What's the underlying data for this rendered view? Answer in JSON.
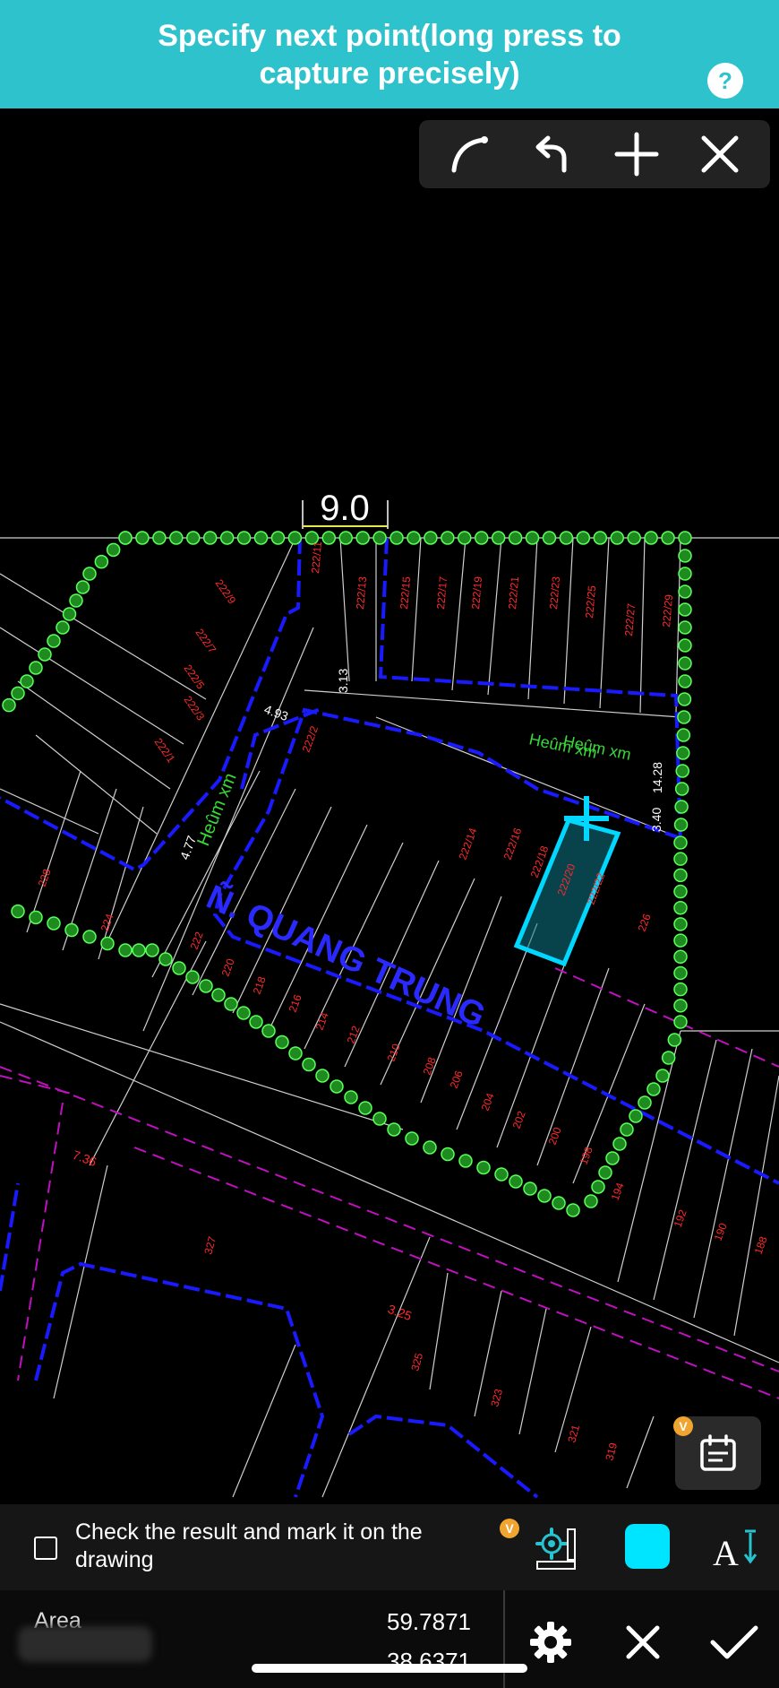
{
  "banner": {
    "title": "Specify next point(long press to capture precisely)",
    "help_icon": "question-mark-icon"
  },
  "toolbar": {
    "items": [
      {
        "name": "arc-tool-button",
        "icon": "arc-icon"
      },
      {
        "name": "undo-button",
        "icon": "undo-arrow-icon"
      },
      {
        "name": "add-point-button",
        "icon": "plus-icon"
      },
      {
        "name": "close-button",
        "icon": "close-icon"
      }
    ]
  },
  "drawing": {
    "dimension_label": "9.0",
    "street_label": "Ñ. QUANG TRUNG",
    "alley_labels": [
      "Heûm xm",
      "Heûm xm",
      "Heûm xm"
    ],
    "side_dims": [
      "4.93",
      "3.13",
      "4.77",
      "14.28",
      "3.40",
      "7.36",
      "3.25"
    ],
    "lot_numbers_top": [
      "222/11",
      "222/13",
      "222/15",
      "222/17",
      "222/19",
      "222/21",
      "222/23",
      "222/25",
      "222/27",
      "222/29"
    ],
    "lot_numbers_left": [
      "222/9",
      "222/7",
      "222/5",
      "222/3",
      "222/1"
    ],
    "lot_numbers_mid": [
      "222/2",
      "222/14",
      "222/16",
      "222/18",
      "222/20",
      "222/22",
      "226",
      "224",
      "228",
      "222",
      "220",
      "218",
      "216",
      "214",
      "212",
      "210",
      "208",
      "206",
      "204",
      "202",
      "200",
      "198",
      "194",
      "192",
      "190",
      "188"
    ],
    "lot_numbers_bottom": [
      "327",
      "325",
      "323",
      "321",
      "319"
    ],
    "colors": {
      "boundary": "#1a1aff",
      "selection": "#00d8ff",
      "green_dots": "#2ecc2e",
      "lot_text": "#ff2a2a",
      "dim_text": "#ffffff",
      "thin_line": "#cfcfcf",
      "magenta": "#c010c0"
    }
  },
  "float_button": {
    "icon": "calendar-list-icon",
    "badge": "V"
  },
  "check_bar": {
    "label": "Check the result and mark it on the drawing",
    "badge": "V",
    "icons": [
      "settings-ruler-icon",
      "color-swatch-icon",
      "text-size-icon"
    ],
    "swatch_color": "#00e5ff"
  },
  "bottom_bar": {
    "area_label": "Area",
    "value_1": "59.7871",
    "value_2": "38.6371",
    "buttons": [
      "settings-gear-icon",
      "cancel-icon",
      "confirm-check-icon"
    ]
  }
}
